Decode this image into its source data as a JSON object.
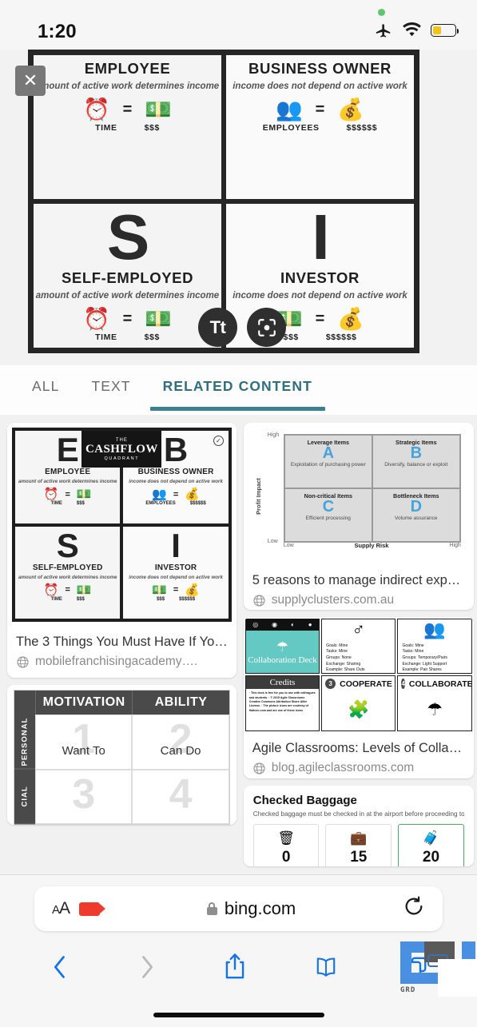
{
  "status_bar": {
    "time": "1:20",
    "airplane_icon": "airplane-mode-icon",
    "wifi_icon": "wifi-icon",
    "battery_icon": "battery-icon",
    "recording_dot": "green-recording-dot"
  },
  "viewer": {
    "close_label": "✕",
    "fab_text_label": "Tt",
    "fab_lens_label": "visual-search-lens",
    "quadrants": [
      {
        "letter": "",
        "title": "EMPLOYEE",
        "subtitle": "amount of active work determines income",
        "left_glyph": "⏰",
        "equals": "=",
        "right_glyph": "💵",
        "left_label": "TIME",
        "right_label": "$$$"
      },
      {
        "letter": "",
        "title": "BUSINESS OWNER",
        "subtitle": "income does not depend on active work",
        "left_glyph": "👥",
        "equals": "=",
        "right_glyph": "💰",
        "left_label": "EMPLOYEES",
        "right_label": "$$$$$$"
      },
      {
        "letter": "S",
        "title": "SELF-EMPLOYED",
        "subtitle": "amount of active work determines income",
        "left_glyph": "⏰",
        "equals": "=",
        "right_glyph": "💵",
        "left_label": "TIME",
        "right_label": "$$$"
      },
      {
        "letter": "I",
        "title": "INVESTOR",
        "subtitle": "income does not depend on active work",
        "left_glyph": "💵",
        "equals": "=",
        "right_glyph": "💰",
        "left_label": "$$$",
        "right_label": "$$$$$$"
      }
    ]
  },
  "tabs": {
    "items": [
      {
        "label": "ALL",
        "active": false
      },
      {
        "label": "TEXT",
        "active": false
      },
      {
        "label": "RELATED CONTENT",
        "active": true
      }
    ],
    "active_color": "#3b7f90"
  },
  "results": {
    "left_column": [
      {
        "title": "The 3 Things You Must Have If Yo…",
        "source": "mobilefranchisingacademy….",
        "thumb_type": "cashflow-quadrant",
        "thumb": {
          "badge": {
            "line1": "THE",
            "line2": "CASHFLOW",
            "line3": "QUADRANT"
          },
          "cells": [
            {
              "letter": "E",
              "title": "EMPLOYEE",
              "subtitle": "amount of active work determines income",
              "g1": "⏰",
              "eq": "=",
              "g2": "💵",
              "l1": "TIME",
              "l2": "$$$"
            },
            {
              "letter": "B",
              "title": "BUSINESS OWNER",
              "subtitle": "income does not depend on active work",
              "g1": "👥",
              "eq": "=",
              "g2": "💰",
              "l1": "EMPLOYEES",
              "l2": "$$$$$$"
            },
            {
              "letter": "S",
              "title": "SELF-EMPLOYED",
              "subtitle": "amount of active work determines income",
              "g1": "⏰",
              "eq": "=",
              "g2": "💵",
              "l1": "TIME",
              "l2": "$$$"
            },
            {
              "letter": "I",
              "title": "INVESTOR",
              "subtitle": "income does not depend on active work",
              "g1": "💵",
              "eq": "=",
              "g2": "💰",
              "l1": "$$$",
              "l2": "$$$$$$"
            }
          ],
          "check_glyph": "✓"
        }
      },
      {
        "title": "",
        "source": "",
        "thumb_type": "motivation-ability-matrix",
        "thumb": {
          "col_headers": [
            "MOTIVATION",
            "ABILITY"
          ],
          "row_headers": [
            "PERSONAL",
            "CIAL"
          ],
          "cells": [
            {
              "num": "1",
              "text": "Want To"
            },
            {
              "num": "2",
              "text": "Can Do"
            },
            {
              "num": "3",
              "text": ""
            },
            {
              "num": "4",
              "text": ""
            }
          ]
        }
      }
    ],
    "right_column": [
      {
        "title": "5 reasons to manage indirect exp…",
        "source": "supplyclusters.com.au",
        "thumb_type": "kraljic-matrix",
        "thumb": {
          "ylabel": "Profit Impact",
          "xlabel": "Supply Risk",
          "y_high": "High",
          "y_low": "Low",
          "x_low": "Low",
          "x_high": "High",
          "quadrants": [
            {
              "title": "Leverage Items",
              "letter": "A",
              "desc": "Exploitation of purchasing power"
            },
            {
              "title": "Strategic Items",
              "letter": "B",
              "desc": "Diversify, balance or exploit"
            },
            {
              "title": "Non-critical Items",
              "letter": "C",
              "desc": "Efficient processing"
            },
            {
              "title": "Bottleneck Items",
              "letter": "D",
              "desc": "Volume assurance"
            }
          ],
          "letter_color": "#46a3db"
        }
      },
      {
        "title": "Agile Classrooms: Levels of Colla…",
        "source": "blog.agileclassrooms.com",
        "thumb_type": "agile-collaboration-deck",
        "thumb": {
          "deck_title": "Collaboration Deck",
          "credits_title": "Credits",
          "credits_body": "· This deck is free for you to use with colleagues and students. · © 2015 Agile Classrooms Creative Commons Attribution Share Alike License. · The picture icons are courtesy of flaticon.com and are use of these icons",
          "panel2_bullets": [
            "Goals: Mine",
            "Tasks: Mine",
            "Groups: None",
            "Exchange: Sharing",
            "Example: Share Outs"
          ],
          "panel3_bullets": [
            "Goals: Mine",
            "Tasks: Mine",
            "Groups: Temporary/Pairs",
            "Exchange: Light Support",
            "Example: Pair Shares"
          ],
          "step3_num": "3",
          "step3_label": "COOPERATE",
          "step4_num": "4",
          "step4_label": "COLLABORATE",
          "teal_color": "#64c9c2"
        }
      },
      {
        "title": "",
        "source": "",
        "thumb_type": "checked-baggage",
        "thumb": {
          "heading": "Checked Baggage",
          "body": "Checked baggage must be checked in at the airport before proceeding to the gat",
          "options": [
            {
              "icon": "no-bag-icon",
              "glyph": "🗑",
              "value": "0",
              "selected": false
            },
            {
              "icon": "suitcase-icon",
              "glyph": "💼",
              "value": "15",
              "selected": false
            },
            {
              "icon": "rolling-bag-icon",
              "glyph": "🧳",
              "value": "20",
              "selected": true
            }
          ],
          "selected_color": "#45b05f"
        }
      }
    ]
  },
  "safari": {
    "text_size_label": "AA",
    "recording_icon": "screen-recording-icon",
    "lock_icon": "lock-icon",
    "url": "bing.com",
    "reload_label": "↻",
    "toolbar": {
      "back_label": "‹",
      "forward_label": "›",
      "share_label": "share-icon",
      "bookmarks_label": "bookmarks-icon",
      "tabs_label": "tabs-icon"
    }
  },
  "watermark": {
    "text": "GRD"
  }
}
